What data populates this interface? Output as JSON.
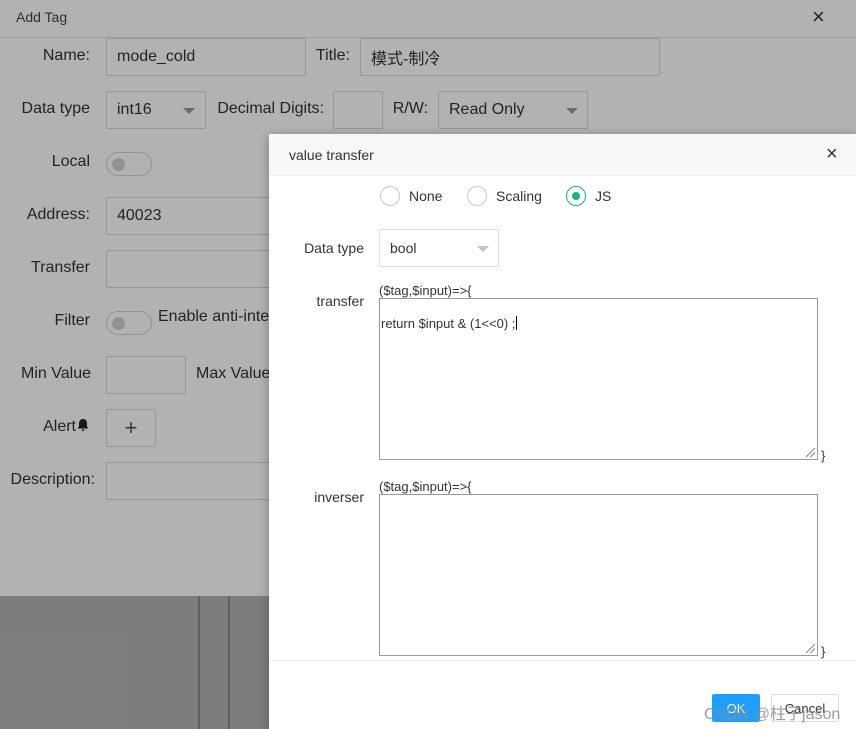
{
  "add_tag": {
    "title": "Add Tag",
    "close_glyph": "×",
    "name_label": "Name:",
    "name_value": "mode_cold",
    "title_label": "Title:",
    "title_value": "模式-制冷",
    "data_type_label": "Data type",
    "data_type_value": "int16",
    "decimal_label": "Decimal Digits:",
    "decimal_value": "",
    "rw_label": "R/W:",
    "rw_value": "Read Only",
    "local_label": "Local",
    "address_label": "Address:",
    "address_value": "40023",
    "transfer_label": "Transfer",
    "filter_label": "Filter",
    "filter_text": "Enable anti-inte",
    "min_label": "Min Value",
    "max_label": "Max Value",
    "alert_label": "Alert",
    "alert_icon": "bell-icon",
    "plus_glyph": "+",
    "description_label": "Description:"
  },
  "value_transfer": {
    "title": "value transfer",
    "close_glyph": "×",
    "modes": [
      {
        "label": "None",
        "selected": false
      },
      {
        "label": "Scaling",
        "selected": false
      },
      {
        "label": "JS",
        "selected": true
      }
    ],
    "data_type_label": "Data type",
    "data_type_value": "bool",
    "transfer_label": "transfer",
    "transfer_signature": "($tag,$input)=>{",
    "transfer_code": "return $input & (1<<0) ;",
    "closing_brace": "}",
    "inverser_label": "inverser",
    "inverser_signature": "($tag,$input)=>{",
    "inverser_code": "",
    "ok_label": "OK",
    "cancel_label": "Cancel"
  },
  "colors": {
    "accent_green": "#16b777",
    "ok_blue": "#1e9fff"
  },
  "watermark": "CSDN @柱子jason"
}
